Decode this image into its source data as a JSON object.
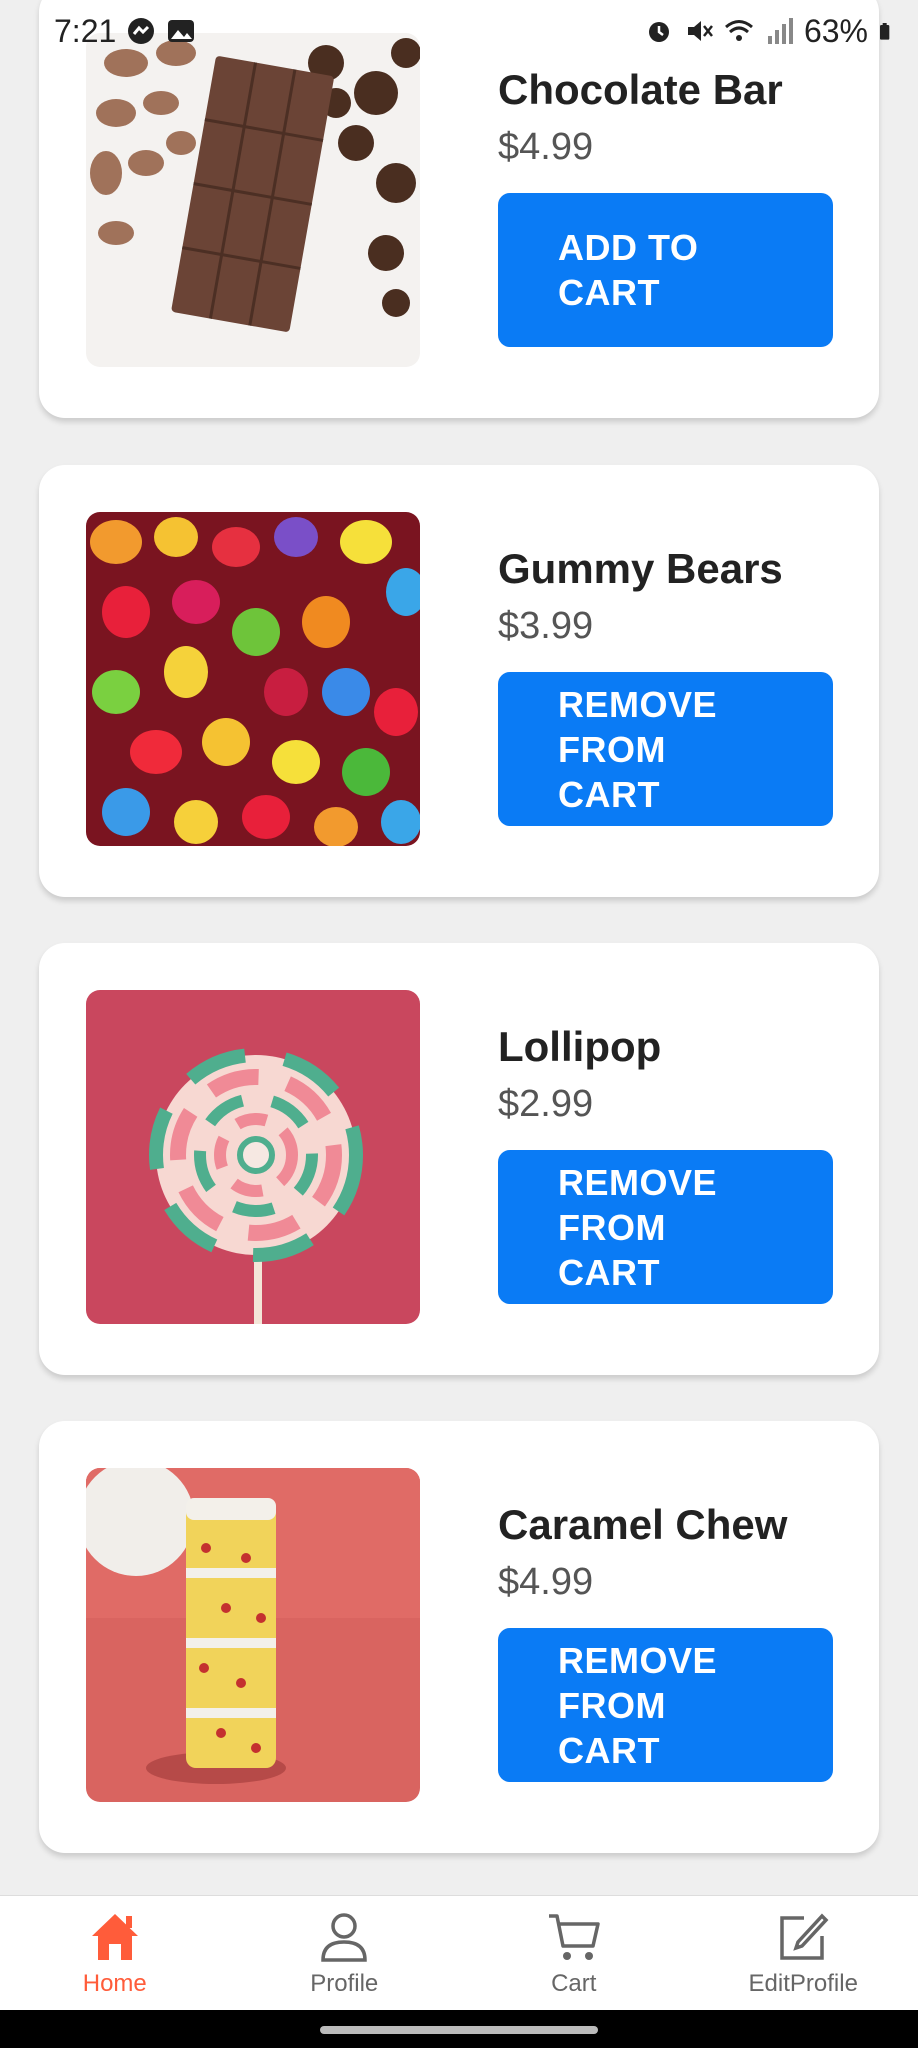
{
  "status_bar": {
    "time": "7:21",
    "battery": "63%"
  },
  "products": [
    {
      "name": "Chocolate Bar",
      "price": "$4.99",
      "button": "ADD TO CART",
      "image_icon": "chocolate-bar-image"
    },
    {
      "name": "Gummy Bears",
      "price": "$3.99",
      "button": "REMOVE FROM CART",
      "image_icon": "gummy-bears-image"
    },
    {
      "name": "Lollipop",
      "price": "$2.99",
      "button": "REMOVE FROM CART",
      "image_icon": "lollipop-image"
    },
    {
      "name": "Caramel Chew",
      "price": "$4.99",
      "button": "REMOVE FROM CART",
      "image_icon": "caramel-chew-image"
    }
  ],
  "nav": {
    "home": "Home",
    "profile": "Profile",
    "cart": "Cart",
    "edit_profile": "EditProfile"
  },
  "colors": {
    "button": "#0a7bf5",
    "nav_active": "#ff5c3a"
  }
}
